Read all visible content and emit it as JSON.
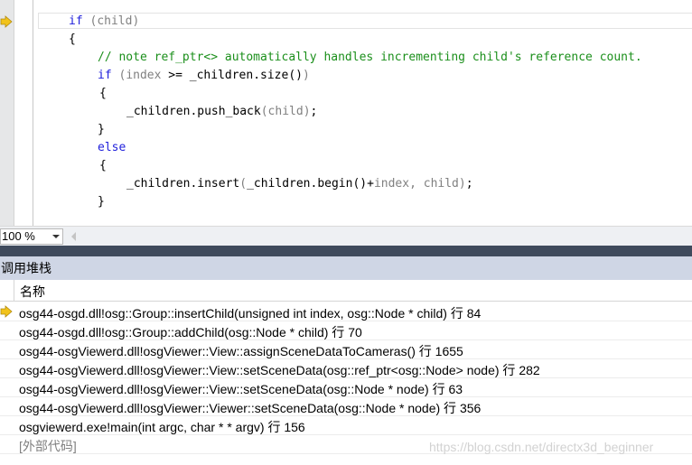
{
  "editor": {
    "lines": [
      [
        [
          "kw",
          "if"
        ],
        [
          "id",
          " "
        ],
        [
          "pm",
          "("
        ],
        [
          "pm",
          "child"
        ],
        [
          "pm",
          ")"
        ]
      ],
      [
        [
          "id",
          "{"
        ]
      ],
      [
        [
          "cm",
          "// note ref_ptr<> automatically handles incrementing child's reference count."
        ]
      ],
      [
        [
          "kw",
          "if"
        ],
        [
          "id",
          " "
        ],
        [
          "pm",
          "("
        ],
        [
          "pm",
          "index"
        ],
        [
          "id",
          " >= _children.size()"
        ],
        [
          "pm",
          ")"
        ]
      ],
      [
        [
          "id",
          "{"
        ]
      ],
      [
        [
          "id",
          "_children.push_back"
        ],
        [
          "pm",
          "("
        ],
        [
          "pm",
          "child"
        ],
        [
          "pm",
          ")"
        ],
        [
          "id",
          ";"
        ]
      ],
      [
        [
          "id",
          "}"
        ]
      ],
      [
        [
          "kw",
          "else"
        ]
      ],
      [
        [
          "id",
          "{"
        ]
      ],
      [
        [
          "id",
          "_children.insert"
        ],
        [
          "pm",
          "("
        ],
        [
          "id",
          "_children.begin()+"
        ],
        [
          "pm",
          "index"
        ],
        [
          "pm",
          ", "
        ],
        [
          "pm",
          "child"
        ],
        [
          "pm",
          ")"
        ],
        [
          "id",
          ";"
        ]
      ],
      [
        [
          "id",
          "}"
        ]
      ]
    ]
  },
  "zoom": {
    "value": "100 %"
  },
  "callstack": {
    "title": "调用堆栈",
    "column_name": "名称",
    "rows": [
      "osg44-osgd.dll!osg::Group::insertChild(unsigned int index, osg::Node * child) 行 84",
      "osg44-osgd.dll!osg::Group::addChild(osg::Node * child) 行 70",
      "osg44-osgViewerd.dll!osgViewer::View::assignSceneDataToCameras() 行 1655",
      "osg44-osgViewerd.dll!osgViewer::View::setSceneData(osg::ref_ptr<osg::Node> node) 行 282",
      "osg44-osgViewerd.dll!osgViewer::View::setSceneData(osg::Node * node) 行 63",
      "osg44-osgViewerd.dll!osgViewer::Viewer::setSceneData(osg::Node * node) 行 356",
      "osgviewerd.exe!main(int argc, char * * argv) 行 156",
      "[外部代码]"
    ]
  },
  "watermark": "https://blog.csdn.net/directx3d_beginner",
  "colors": {
    "keyword": "#1f1fdb",
    "comment": "#1b8f1b",
    "param": "#808080",
    "arrow": "#f2c31b"
  },
  "icons": {
    "current_statement": "yellow-arrow-icon"
  }
}
